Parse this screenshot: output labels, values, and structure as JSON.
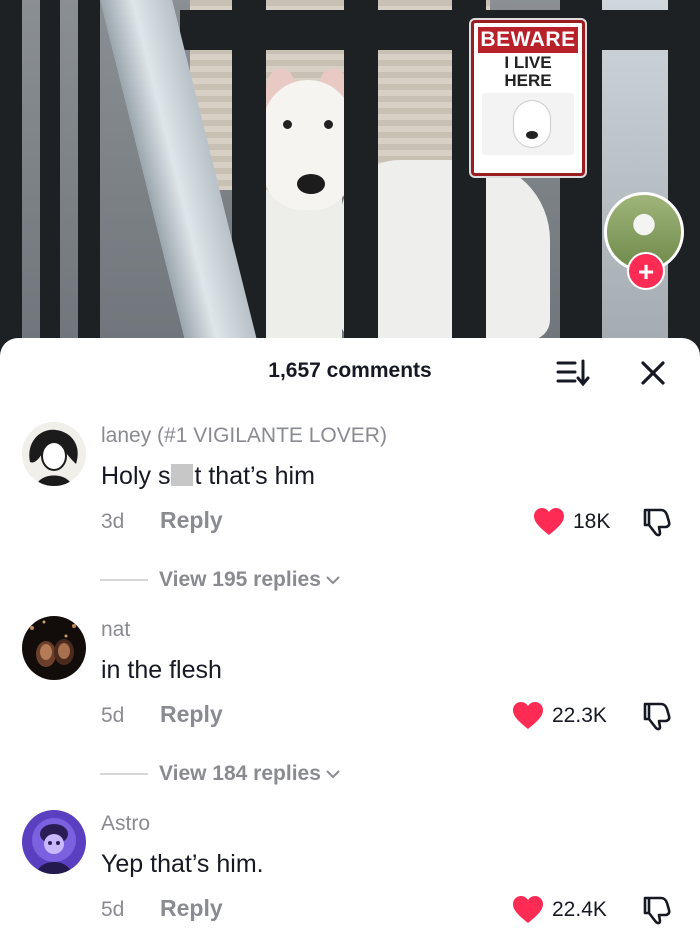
{
  "photo": {
    "sign_header": "BEWARE",
    "sign_line1": "I LIVE",
    "sign_line2": "HERE",
    "follow_icon": "+"
  },
  "sheet": {
    "title": "1,657 comments"
  },
  "colors": {
    "like_red": "#fe2c55",
    "muted_text": "#8a8b91",
    "primary_text": "#161823"
  },
  "comments": [
    {
      "username": "laney (#1 VIGILANTE LOVER)",
      "text_before": "Holy s",
      "text_after": "t that’s him",
      "age": "3d",
      "reply_label": "Reply",
      "likes": "18K",
      "view_replies": "View 195 replies"
    },
    {
      "username": "nat",
      "text": "in the flesh",
      "age": "5d",
      "reply_label": "Reply",
      "likes": "22.3K",
      "view_replies": "View 184 replies"
    },
    {
      "username": "Astro",
      "text": "Yep that’s him.",
      "age": "5d",
      "reply_label": "Reply",
      "likes": "22.4K"
    }
  ]
}
